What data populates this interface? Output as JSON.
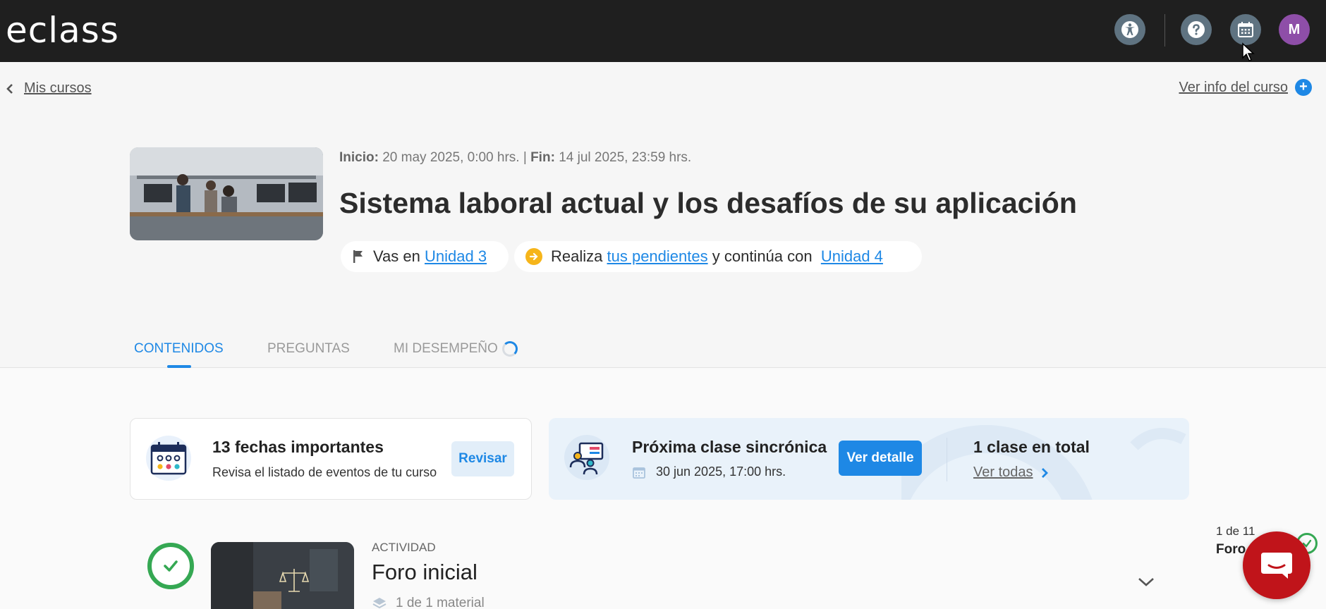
{
  "app": {
    "logo_text": "eclass",
    "avatar_initial": "M"
  },
  "nav": {
    "back_label": "Mis cursos",
    "info_label": "Ver info del curso"
  },
  "course": {
    "start_label": "Inicio:",
    "start_value": "20 may 2025, 0:00 hrs.",
    "separator": "|",
    "end_label": "Fin:",
    "end_value": "14 jul 2025, 23:59 hrs.",
    "title": "Sistema laboral actual y los desafíos de su aplicación",
    "progress_prefix": "Vas en",
    "progress_unit": "Unidad 3",
    "next_prefix": "Realiza",
    "next_link": "tus pendientes",
    "next_middle": "y continúa con",
    "next_unit": "Unidad 4"
  },
  "tabs": [
    {
      "label": "CONTENIDOS",
      "active": true
    },
    {
      "label": "PREGUNTAS",
      "active": false
    },
    {
      "label": "MI DESEMPEÑO",
      "active": false
    }
  ],
  "dates_card": {
    "title": "13 fechas importantes",
    "subtitle": "Revisa el listado de eventos de tu curso",
    "button": "Revisar"
  },
  "sync_card": {
    "title": "Próxima clase sincrónica",
    "date": "30 jun 2025, 17:00 hrs.",
    "button": "Ver detalle",
    "total": "1 clase en total",
    "link": "Ver todas"
  },
  "activity": {
    "type": "ACTIVIDAD",
    "title": "Foro inicial",
    "materials": "1 de 1 material",
    "counter": "1 de 11",
    "counter_name": "Foro"
  },
  "colors": {
    "topbar": "#1f1f1f",
    "accent": "#1e88e5",
    "success": "#35a853",
    "warning": "#f6b51a",
    "avatar": "#8e4ea8",
    "chat": "#c0141a"
  }
}
